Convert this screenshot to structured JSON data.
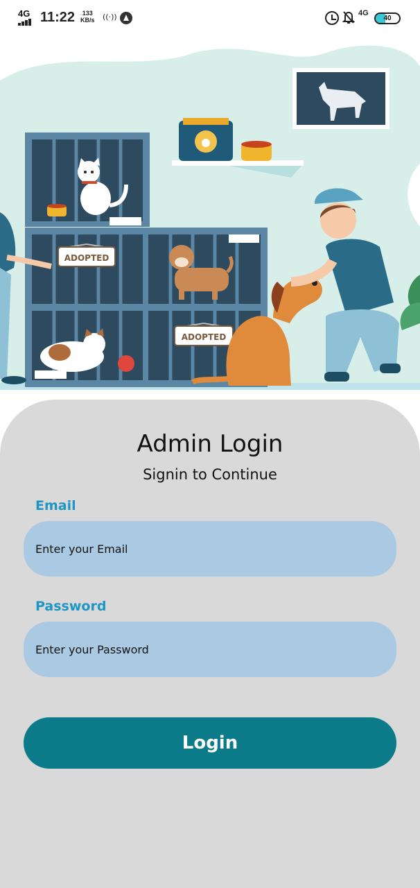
{
  "status_bar": {
    "network": "4G",
    "time": "11:22",
    "data_speed": "133",
    "data_speed_unit": "KB/s",
    "network2": "4G",
    "battery_level": "40",
    "icons": [
      "signal-icon",
      "wifi-calling-icon",
      "navigation-icon",
      "alarm-icon",
      "mute-bell-icon",
      "battery-icon"
    ]
  },
  "hero": {
    "sign_left": "ADOPTED",
    "sign_right": "ADOPTED"
  },
  "login": {
    "title": "Admin Login",
    "subtitle": "Signin to Continue",
    "email_label": "Email",
    "email_placeholder": "Enter your Email",
    "password_label": "Password",
    "password_placeholder": "Enter your Password",
    "button_label": "Login"
  },
  "colors": {
    "panel_bg": "#d9d9d9",
    "input_bg": "#a9cae2",
    "label": "#1e96c4",
    "button": "#0b7b8a",
    "hero_bg": "#d8efe9"
  }
}
